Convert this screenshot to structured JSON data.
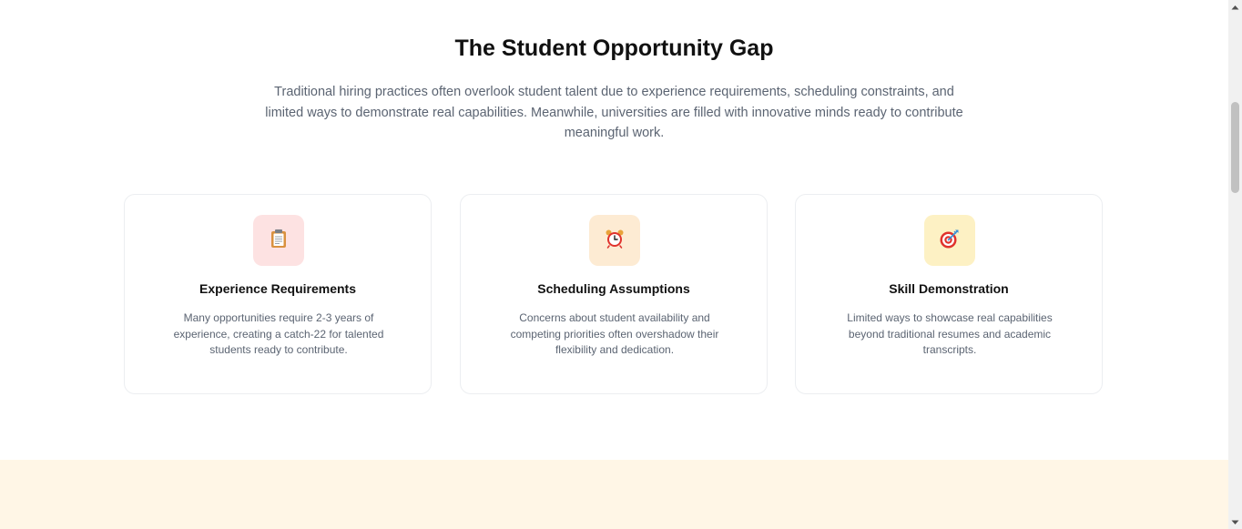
{
  "gap_section": {
    "title": "The Student Opportunity Gap",
    "intro": "Traditional hiring practices often overlook student talent due to experience requirements, scheduling constraints, and limited ways to demonstrate real capabilities. Meanwhile, universities are filled with innovative minds ready to contribute meaningful work.",
    "cards": [
      {
        "icon": "clipboard-icon",
        "icon_bg": "#fde2e2",
        "title": "Experience Requirements",
        "text": "Many opportunities require 2-3 years of experience, creating a catch-22 for talented students ready to contribute."
      },
      {
        "icon": "alarm-clock-icon",
        "icon_bg": "#fdebd3",
        "title": "Scheduling Assumptions",
        "text": "Concerns about student availability and competing priorities often overshadow their flexibility and dedication."
      },
      {
        "icon": "target-icon",
        "icon_bg": "#fdf1c4",
        "title": "Skill Demonstration",
        "text": "Limited ways to showcase real capabilities beyond traditional resumes and academic transcripts."
      }
    ]
  },
  "colors": {
    "heading": "#111111",
    "body_text": "#5b6472",
    "card_border": "#eceef1",
    "next_section_bg": "#fff6e6"
  }
}
